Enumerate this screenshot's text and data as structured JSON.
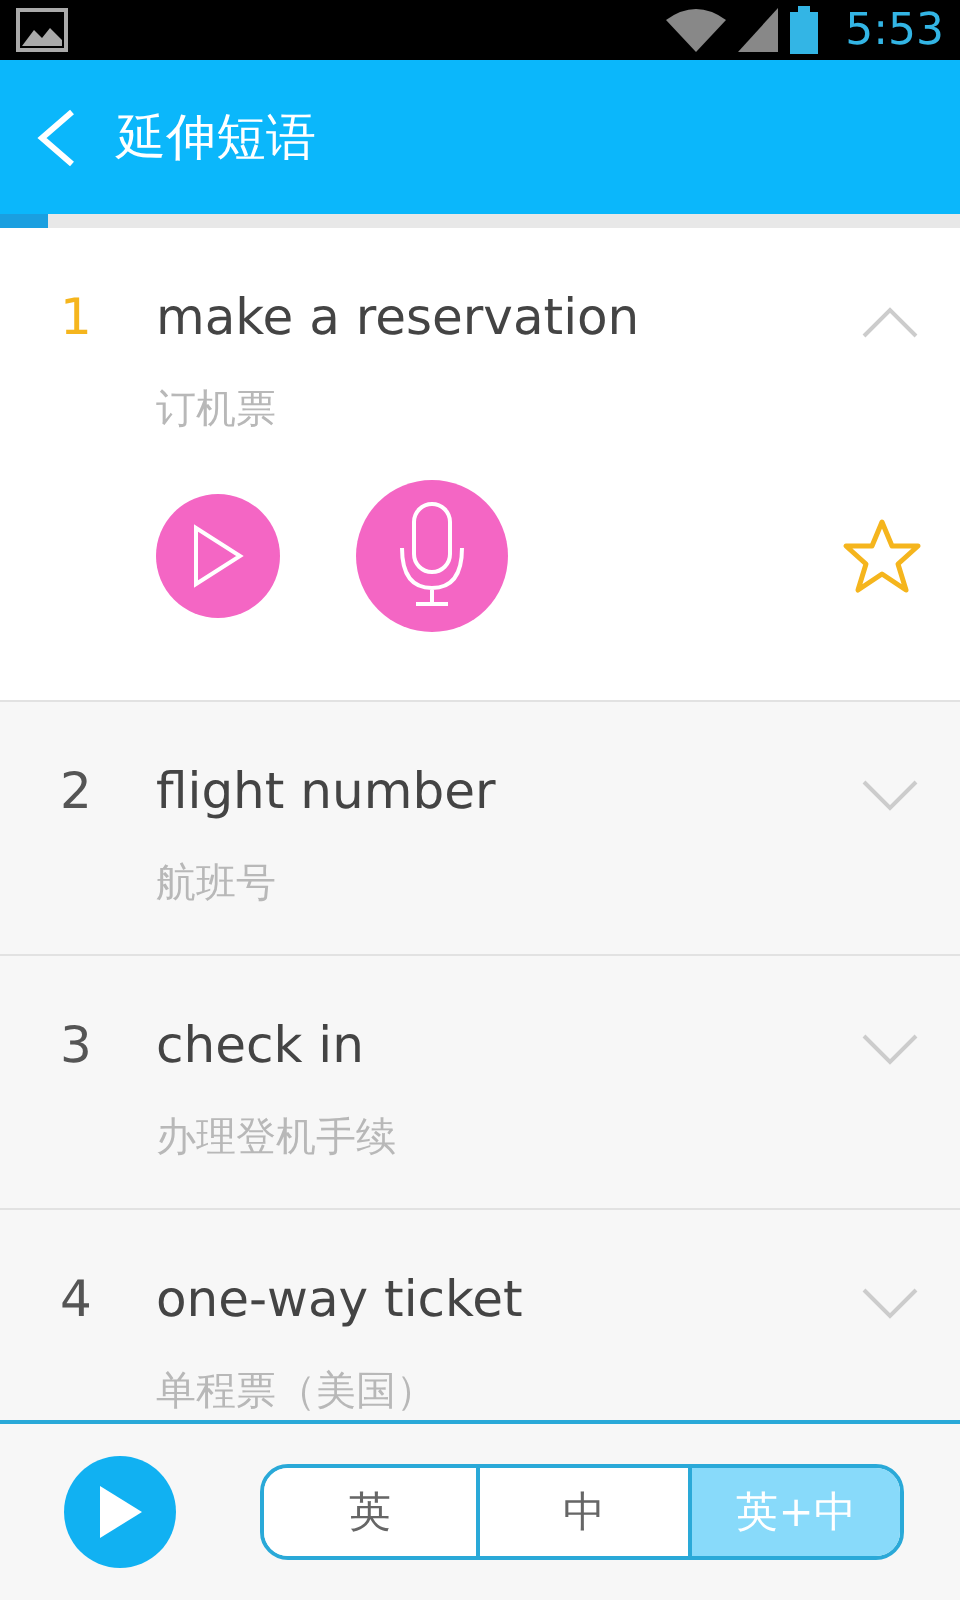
{
  "status_bar": {
    "time": "5:53"
  },
  "header": {
    "title": "延伸短语"
  },
  "progress": {
    "level": 0.05
  },
  "phrases": [
    {
      "number": "1",
      "english": "make a reservation",
      "chinese": "订机票",
      "expanded": true,
      "starred": false
    },
    {
      "number": "2",
      "english": "flight number",
      "chinese": "航班号",
      "expanded": false
    },
    {
      "number": "3",
      "english": "check in",
      "chinese": "办理登机手续",
      "expanded": false
    },
    {
      "number": "4",
      "english": "one-way ticket",
      "chinese": "单程票（美国）",
      "expanded": false
    }
  ],
  "modes": [
    {
      "label": "英",
      "selected": false
    },
    {
      "label": "中",
      "selected": false
    },
    {
      "label": "英+中",
      "selected": true
    }
  ]
}
